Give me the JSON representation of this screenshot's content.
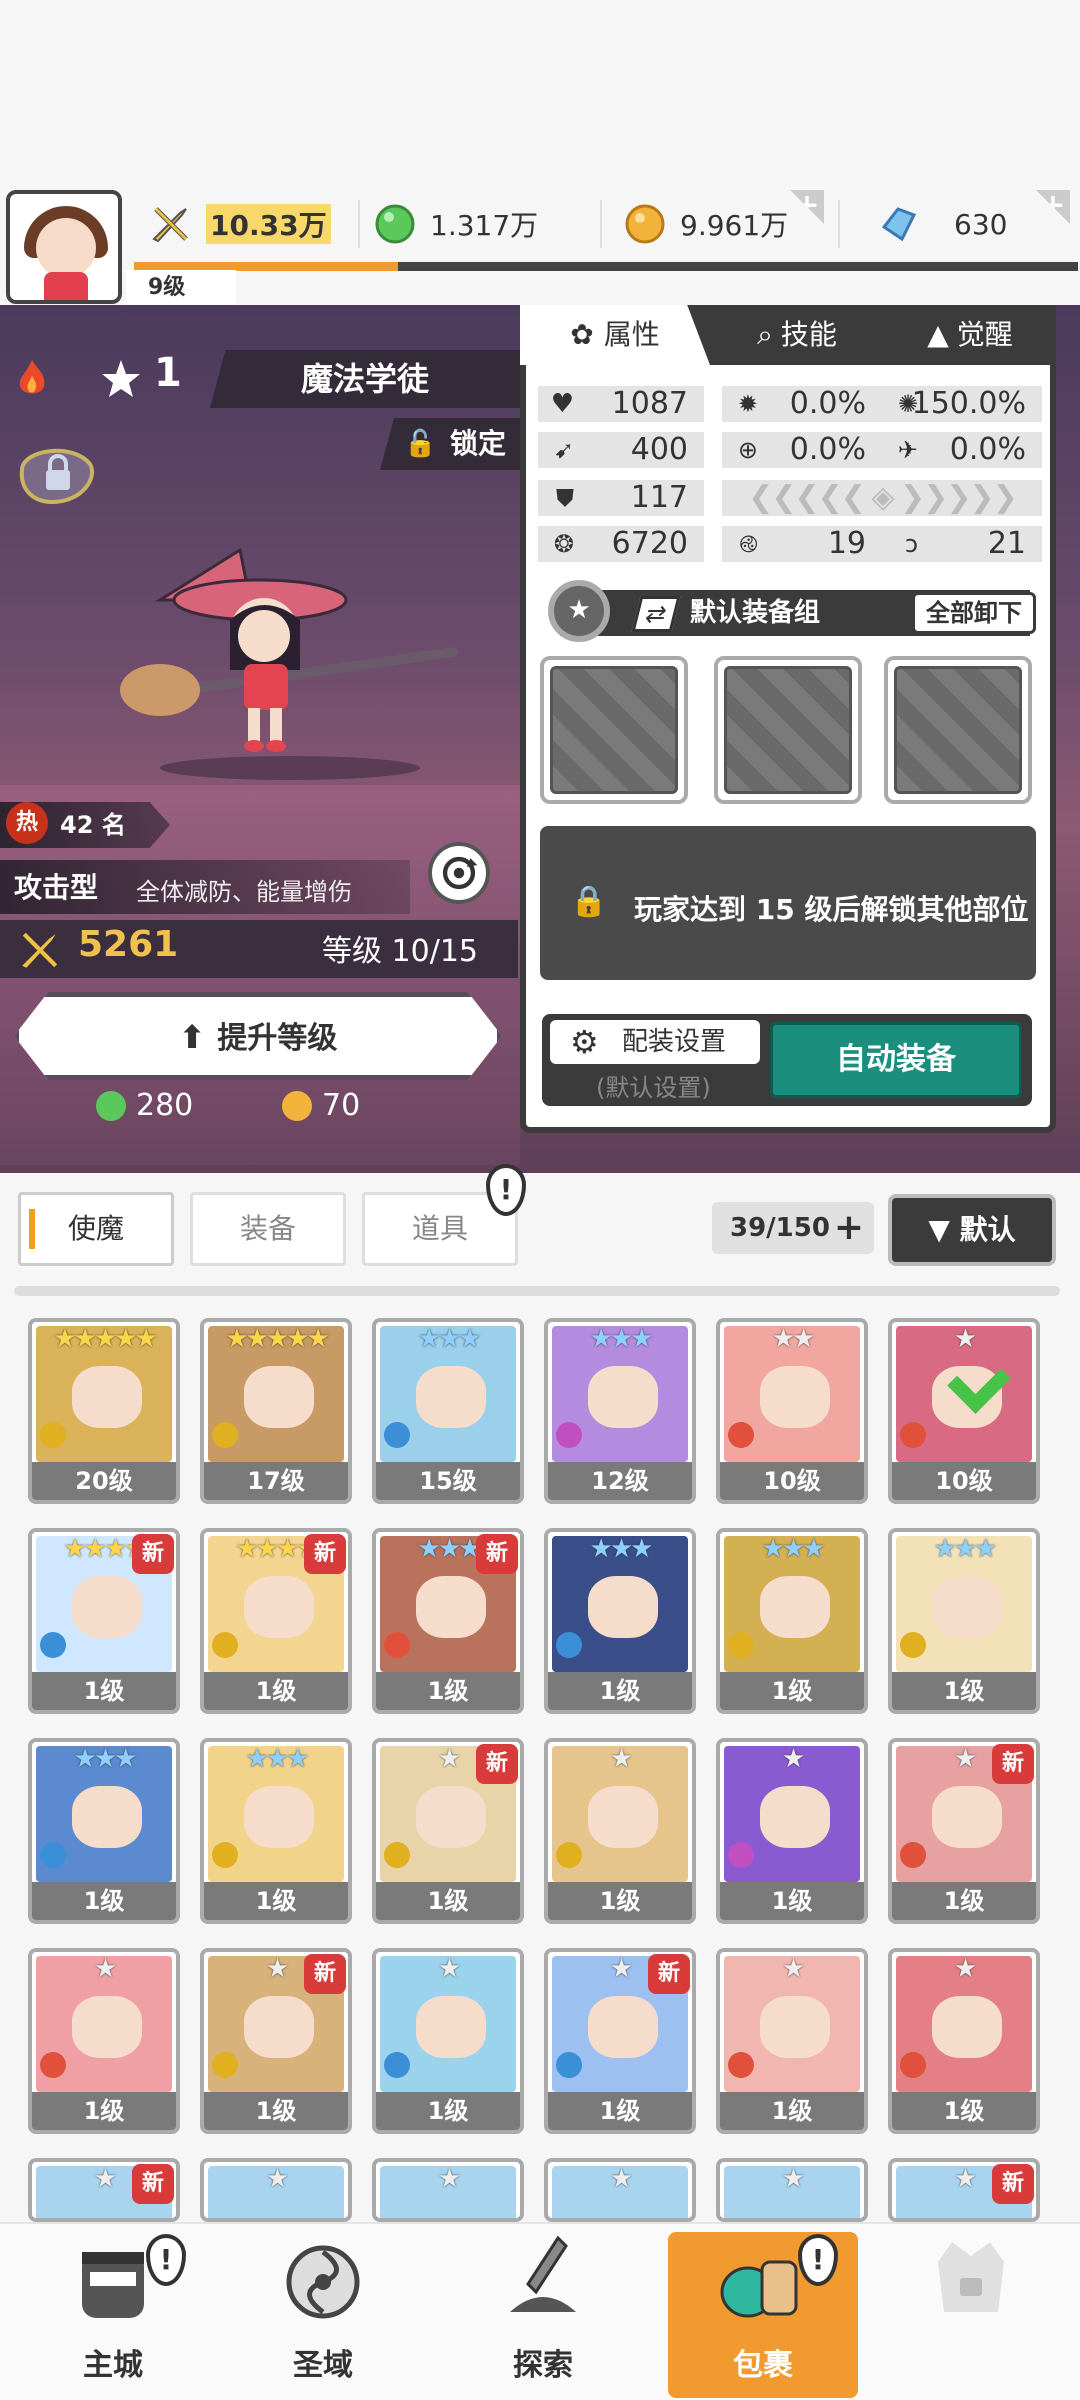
{
  "header": {
    "player_level": "9级",
    "xp_progress": 0.28,
    "resources": [
      {
        "name": "power",
        "icon": "sword-power-icon",
        "value": "10.33万"
      },
      {
        "name": "green-gem",
        "icon": "green-orb-icon",
        "value": "1.317万"
      },
      {
        "name": "gold",
        "icon": "gold-coin-icon",
        "value": "9.961万"
      },
      {
        "name": "diamond",
        "icon": "blue-crystal-icon",
        "value": "630"
      }
    ]
  },
  "hero": {
    "rarity": "1",
    "name": "魔法学徒",
    "lock_label": "锁定",
    "heat_badge": "热",
    "heat_rank": "42 名",
    "role_type": "攻击型",
    "role_desc": "全体减防、能量增伤",
    "power": "5261",
    "level_label": "等级 10/15",
    "upgrade_label": "提升等级",
    "cost_green": "280",
    "cost_gold": "70"
  },
  "panel": {
    "tabs": [
      "属性",
      "技能",
      "觉醒"
    ],
    "stats": {
      "hp": "1087",
      "atk": "400",
      "def": "117",
      "power": "6720",
      "crit": "0.0%",
      "crit_dmg": "150.0%",
      "hit": "0.0%",
      "dodge": "0.0%",
      "stat_a": "19",
      "stat_b": "21"
    },
    "equip_group": "默认装备组",
    "unload_all": "全部卸下",
    "locked_msg": "玩家达到 15 级后解锁其他部位",
    "setting_label": "配装设置",
    "setting_sub": "(默认设置)",
    "auto_equip": "自动装备"
  },
  "inventory": {
    "categories": [
      "使魔",
      "装备",
      "道具"
    ],
    "count": "39/150",
    "sort_label": "▼ 默认",
    "cards": [
      {
        "level": "20级",
        "stars": "★★★★★",
        "tier": "gold",
        "new": false,
        "color": "#d9b25a",
        "elem": "#e0b020"
      },
      {
        "level": "17级",
        "stars": "★★★★★",
        "tier": "gold",
        "new": false,
        "color": "#c79a66",
        "elem": "#e0b020"
      },
      {
        "level": "15级",
        "stars": "★★★",
        "tier": "blue",
        "new": false,
        "color": "#9bd0ea",
        "elem": "#3a8fd6"
      },
      {
        "level": "12级",
        "stars": "★★★",
        "tier": "blue",
        "new": false,
        "color": "#b58be0",
        "elem": "#c04fc0"
      },
      {
        "level": "10级",
        "stars": "★★",
        "tier": "gray",
        "new": false,
        "color": "#f2a6a0",
        "elem": "#e0503a"
      },
      {
        "level": "10级",
        "stars": "★",
        "tier": "gray",
        "new": false,
        "color": "#d86a84",
        "elem": "#e0503a",
        "checked": true
      },
      {
        "level": "1级",
        "stars": "★★★★",
        "tier": "gold",
        "new": true,
        "new_label": "新",
        "color": "#cfe8ff",
        "elem": "#3a8fd6"
      },
      {
        "level": "1级",
        "stars": "★★★★",
        "tier": "gold",
        "new": true,
        "new_label": "新",
        "color": "#f3d590",
        "elem": "#e0b020"
      },
      {
        "level": "1级",
        "stars": "★★★",
        "tier": "blue",
        "new": true,
        "new_label": "新",
        "color": "#b9735c",
        "elem": "#e0503a"
      },
      {
        "level": "1级",
        "stars": "★★★",
        "tier": "blue",
        "new": false,
        "color": "#3a4f8a",
        "elem": "#3a8fd6"
      },
      {
        "level": "1级",
        "stars": "★★★",
        "tier": "blue",
        "new": false,
        "color": "#d3b052",
        "elem": "#e0b020"
      },
      {
        "level": "1级",
        "stars": "★★★",
        "tier": "blue",
        "new": false,
        "color": "#f3e2b8",
        "elem": "#e0b020"
      },
      {
        "level": "1级",
        "stars": "★★★",
        "tier": "blue",
        "new": false,
        "color": "#5b8ad0",
        "elem": "#3a8fd6"
      },
      {
        "level": "1级",
        "stars": "★★★",
        "tier": "blue",
        "new": false,
        "color": "#f2d38a",
        "elem": "#e0b020"
      },
      {
        "level": "1级",
        "stars": "★",
        "tier": "gray",
        "new": true,
        "new_label": "新",
        "color": "#e8d4a8",
        "elem": "#e0b020"
      },
      {
        "level": "1级",
        "stars": "★",
        "tier": "gray",
        "new": false,
        "color": "#e6c58c",
        "elem": "#e0b020"
      },
      {
        "level": "1级",
        "stars": "★",
        "tier": "gray",
        "new": false,
        "color": "#8a5bd0",
        "elem": "#c04fc0"
      },
      {
        "level": "1级",
        "stars": "★",
        "tier": "gray",
        "new": true,
        "new_label": "新",
        "color": "#e7a1a1",
        "elem": "#e0503a"
      },
      {
        "level": "1级",
        "stars": "★",
        "tier": "gray",
        "new": false,
        "color": "#f0a0a4",
        "elem": "#e0503a"
      },
      {
        "level": "1级",
        "stars": "★",
        "tier": "gray",
        "new": true,
        "new_label": "新",
        "color": "#d7b27a",
        "elem": "#e0b020"
      },
      {
        "level": "1级",
        "stars": "★",
        "tier": "gray",
        "new": false,
        "color": "#9cd3ec",
        "elem": "#3a8fd6"
      },
      {
        "level": "1级",
        "stars": "★",
        "tier": "gray",
        "new": true,
        "new_label": "新",
        "color": "#9cc0f0",
        "elem": "#3a8fd6"
      },
      {
        "level": "1级",
        "stars": "★",
        "tier": "gray",
        "new": false,
        "color": "#f2b6b0",
        "elem": "#e0503a"
      },
      {
        "level": "1级",
        "stars": "★",
        "tier": "gray",
        "new": false,
        "color": "#e57f86",
        "elem": "#e0503a"
      }
    ],
    "partial_row_new": [
      true,
      false,
      false,
      false,
      false,
      true
    ],
    "partial_row_new_label": "新"
  },
  "nav": [
    {
      "label": "主城",
      "icon": "castle-helmet-icon",
      "alert": true
    },
    {
      "label": "圣域",
      "icon": "vortex-icon",
      "alert": false
    },
    {
      "label": "探索",
      "icon": "sword-in-stone-icon",
      "alert": false
    },
    {
      "label": "包裹",
      "icon": "backpack-icon",
      "alert": true,
      "active": true
    },
    {
      "label": "",
      "icon": "locked-slot-icon",
      "alert": false
    }
  ],
  "colors": {
    "accent_orange": "#f09a30",
    "teal_button": "#1a8f7e",
    "panel_dark": "#3b3b3b"
  }
}
